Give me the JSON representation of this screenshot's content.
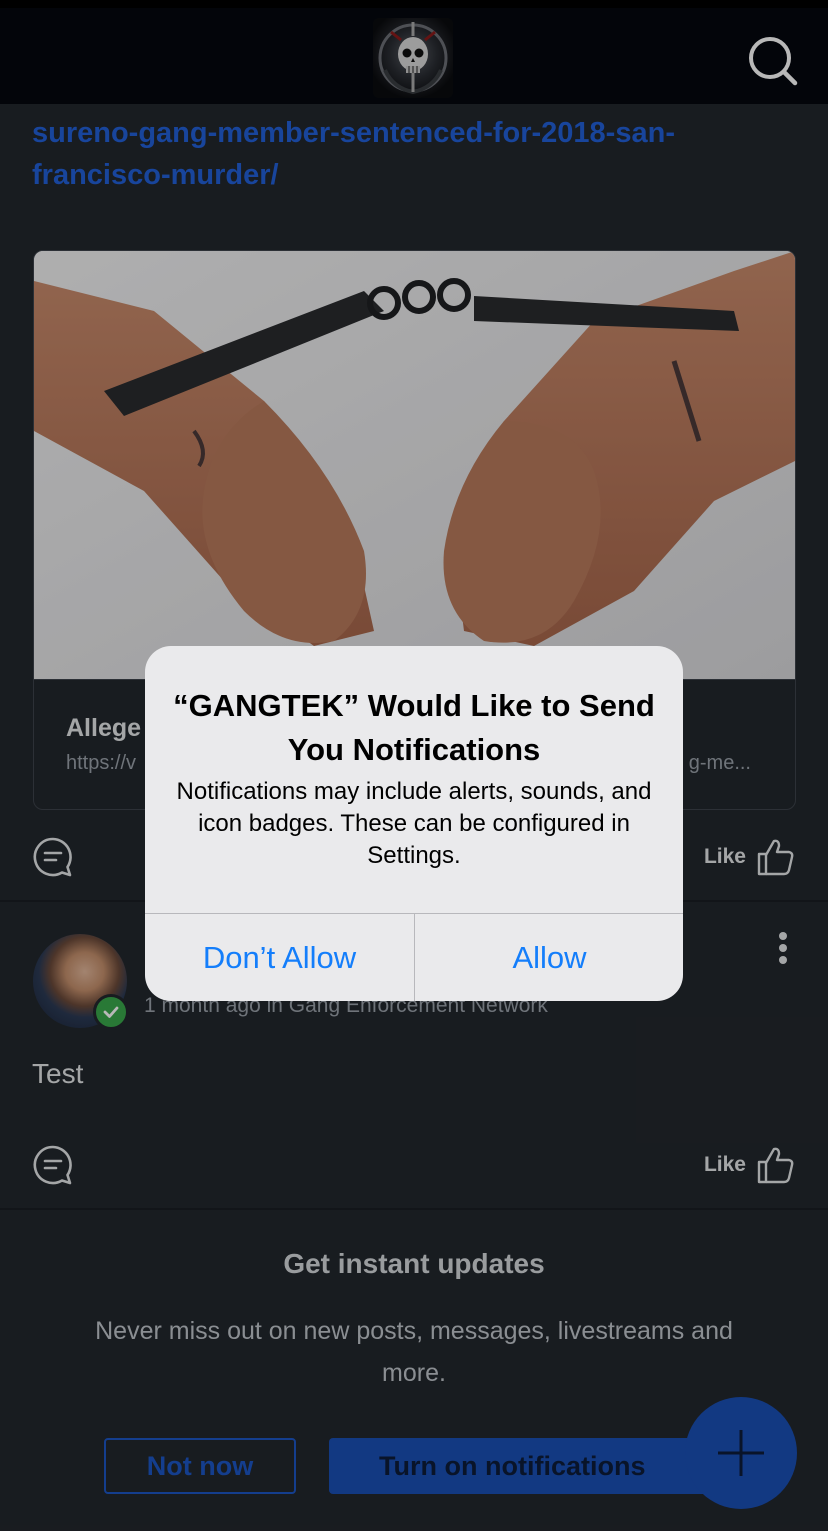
{
  "header": {
    "logo_name": "gangtek-skull-logo",
    "search_icon": "search-icon"
  },
  "post1": {
    "link_lines": [
      "sureno-gang-member-sentenced-for-2018-san-",
      "francisco-murder/"
    ],
    "card_title": "Allege",
    "card_url": "https://v",
    "card_url_tail": "g-me...",
    "like_label": "Like"
  },
  "post2": {
    "meta": "1 month ago in Gang Enforcement Network",
    "body": "Test",
    "like_label": "Like"
  },
  "promo": {
    "title": "Get instant updates",
    "text": "Never miss out on new posts, messages, livestreams and more.",
    "not_now_label": "Not now",
    "turn_on_label": "Turn on notifications"
  },
  "alert": {
    "title": "“GANGTEK” Would Like to Send You Notifications",
    "message": "Notifications may include alerts, sounds, and icon badges. These can be configured in Settings.",
    "dont_allow_label": "Don’t Allow",
    "allow_label": "Allow"
  },
  "colors": {
    "background": "#22272d",
    "topbar": "#05080f",
    "link_blue": "#2260d9",
    "accent_blue": "#1a4fb5",
    "ios_blue": "#147efb",
    "verified_green": "#3aa84b"
  }
}
